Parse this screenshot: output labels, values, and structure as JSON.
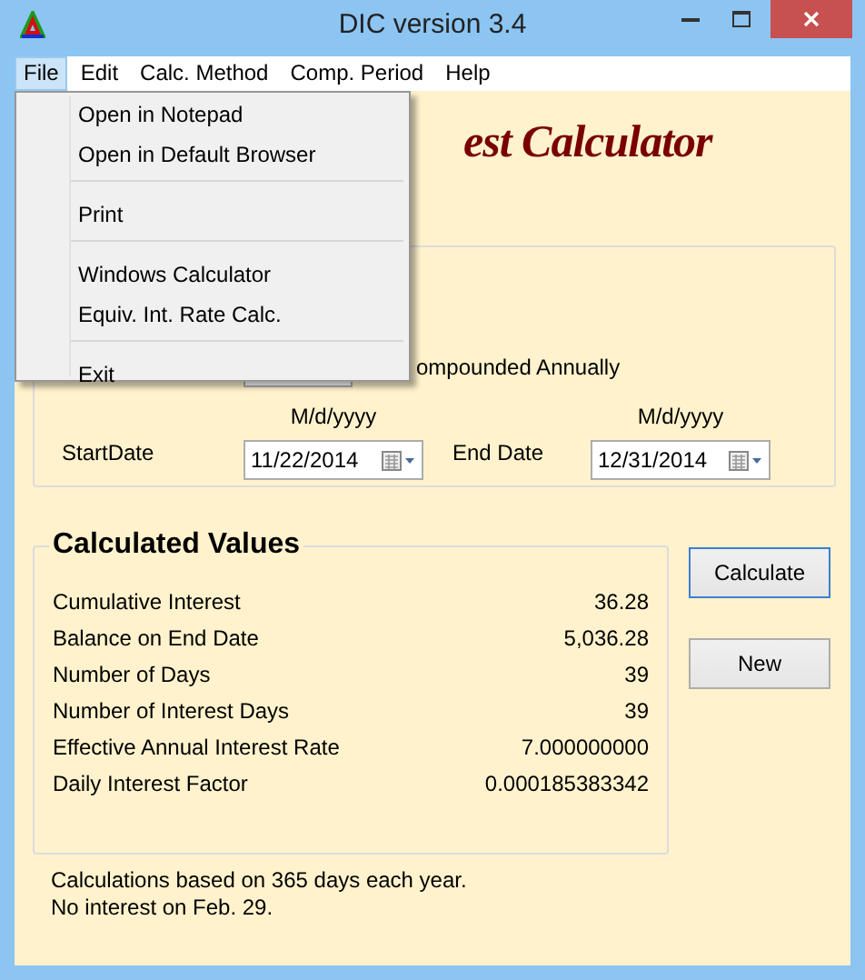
{
  "window": {
    "title": "DIC version 3.4"
  },
  "menu_bar": [
    {
      "label": "File",
      "selected": true
    },
    {
      "label": "Edit",
      "selected": false
    },
    {
      "label": "Calc. Method",
      "selected": false
    },
    {
      "label": "Comp. Period",
      "selected": false
    },
    {
      "label": "Help",
      "selected": false
    }
  ],
  "file_menu": [
    {
      "kind": "item",
      "label": "Open in Notepad"
    },
    {
      "kind": "item",
      "label": "Open in Default Browser"
    },
    {
      "kind": "separator"
    },
    {
      "kind": "item",
      "label": "Print"
    },
    {
      "kind": "separator"
    },
    {
      "kind": "item",
      "label": "Windows Calculator"
    },
    {
      "kind": "item",
      "label": "Equiv. Int. Rate Calc."
    },
    {
      "kind": "separator"
    },
    {
      "kind": "item",
      "label": "Exit"
    }
  ],
  "heading": "est Calculator",
  "compounding": {
    "label": "ompounded Annually"
  },
  "dates": [
    {
      "label": "StartDate",
      "format": "M/d/yyyy",
      "value": "11/22/2014"
    },
    {
      "label": "End Date",
      "format": "M/d/yyyy",
      "value": "12/31/2014"
    }
  ],
  "calculated_values": {
    "title": "Calculated Values",
    "rows": [
      {
        "label": "Cumulative Interest",
        "value": "36.28"
      },
      {
        "label": "Balance on End Date",
        "value": "5,036.28"
      },
      {
        "label": "Number of Days",
        "value": "39"
      },
      {
        "label": "Number of Interest Days",
        "value": "39"
      },
      {
        "label": "Effective Annual Interest Rate",
        "value": "7.000000000"
      },
      {
        "label": "Daily Interest Factor",
        "value": "0.000185383342"
      }
    ]
  },
  "buttons": [
    {
      "label": "Calculate",
      "focused": true
    },
    {
      "label": "New",
      "focused": false
    }
  ],
  "notes": [
    "Calculations based on 365 days each year.",
    "No interest on Feb. 29."
  ]
}
